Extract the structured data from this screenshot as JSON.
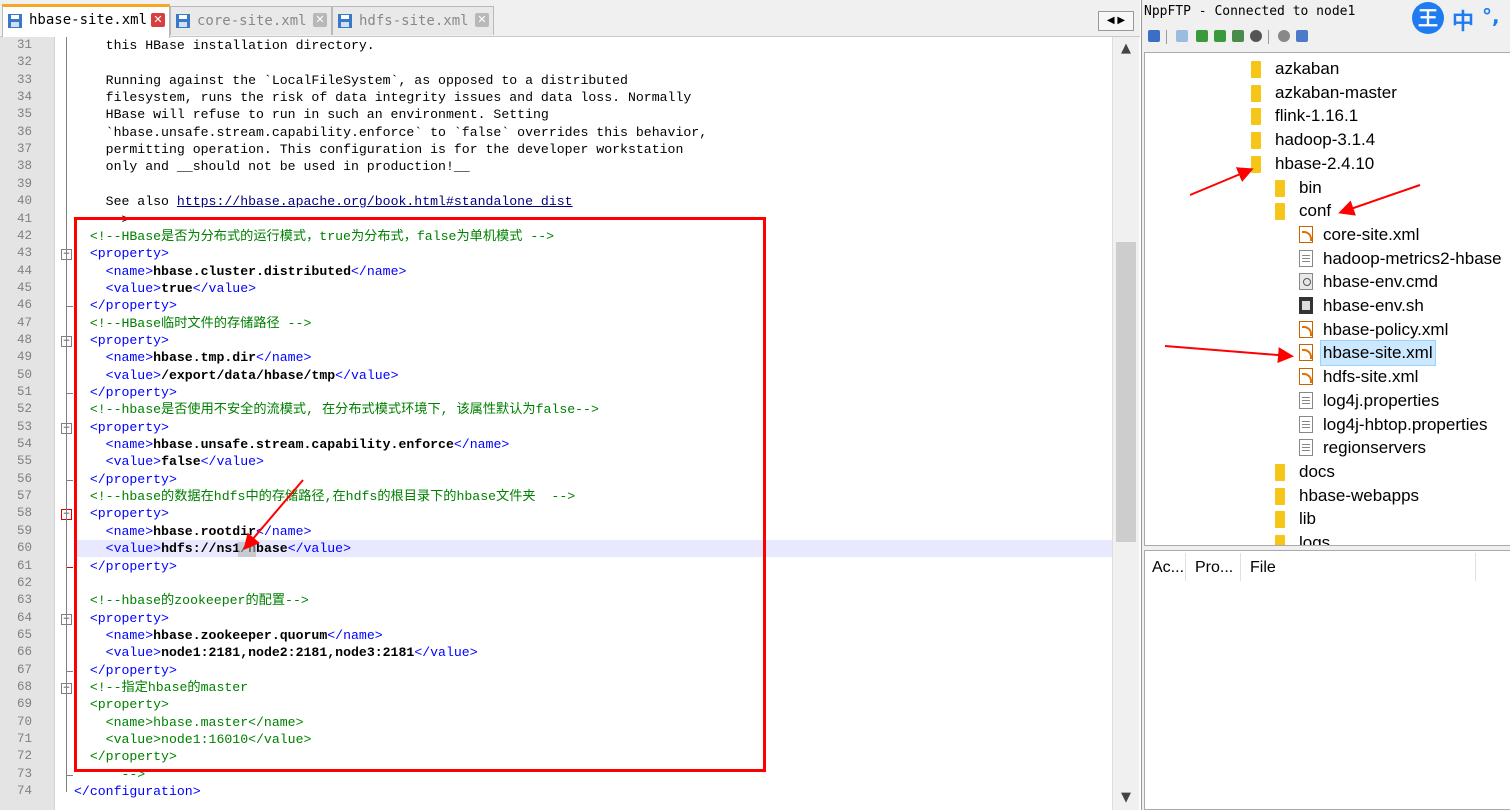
{
  "editor": {
    "tabs": [
      {
        "label": "hbase-site.xml",
        "active": true
      },
      {
        "label": "core-site.xml",
        "active": false
      },
      {
        "label": "hdfs-site.xml",
        "active": false
      }
    ],
    "tab_arrows": "◀ ▶",
    "lines": [
      {
        "n": "31",
        "parts": [
          [
            "plain",
            "    this HBase installation directory."
          ]
        ]
      },
      {
        "n": "32",
        "parts": []
      },
      {
        "n": "33",
        "parts": [
          [
            "plain",
            "    Running against the `LocalFileSystem`, as opposed to a distributed"
          ]
        ]
      },
      {
        "n": "34",
        "parts": [
          [
            "plain",
            "    filesystem, runs the risk of data integrity issues and data loss. Normally"
          ]
        ]
      },
      {
        "n": "35",
        "parts": [
          [
            "plain",
            "    HBase will refuse to run in such an environment. Setting"
          ]
        ]
      },
      {
        "n": "36",
        "parts": [
          [
            "plain",
            "    `hbase.unsafe.stream.capability.enforce` to `false` overrides this behavior,"
          ]
        ]
      },
      {
        "n": "37",
        "parts": [
          [
            "plain",
            "    permitting operation. This configuration is for the developer workstation"
          ]
        ]
      },
      {
        "n": "38",
        "parts": [
          [
            "plain",
            "    only and __should not be used in production!__"
          ]
        ]
      },
      {
        "n": "39",
        "parts": []
      },
      {
        "n": "40",
        "parts": [
          [
            "plain",
            "    See also "
          ],
          [
            "link",
            "https://hbase.apache.org/book.html#standalone_dist"
          ]
        ]
      },
      {
        "n": "41",
        "parts": [
          [
            "plain",
            "    -->"
          ]
        ]
      },
      {
        "n": "42",
        "parts": [
          [
            "comment",
            "  <!--HBase是否为分布式的运行模式，true为分布式，false为单机模式 -->"
          ]
        ]
      },
      {
        "n": "43",
        "parts": [
          [
            "tag",
            "  <property>"
          ]
        ]
      },
      {
        "n": "44",
        "parts": [
          [
            "tag",
            "    <name>"
          ],
          [
            "text",
            "hbase.cluster.distributed"
          ],
          [
            "tag",
            "</name>"
          ]
        ]
      },
      {
        "n": "45",
        "parts": [
          [
            "tag",
            "    <value>"
          ],
          [
            "text",
            "true"
          ],
          [
            "tag",
            "</value>"
          ]
        ]
      },
      {
        "n": "46",
        "parts": [
          [
            "tag",
            "  </property>"
          ]
        ]
      },
      {
        "n": "47",
        "parts": [
          [
            "comment",
            "  <!--HBase临时文件的存储路径 -->"
          ]
        ]
      },
      {
        "n": "48",
        "parts": [
          [
            "tag",
            "  <property>"
          ]
        ]
      },
      {
        "n": "49",
        "parts": [
          [
            "tag",
            "    <name>"
          ],
          [
            "text",
            "hbase.tmp.dir"
          ],
          [
            "tag",
            "</name>"
          ]
        ]
      },
      {
        "n": "50",
        "parts": [
          [
            "tag",
            "    <value>"
          ],
          [
            "text",
            "/export/data/hbase/tmp"
          ],
          [
            "tag",
            "</value>"
          ]
        ]
      },
      {
        "n": "51",
        "parts": [
          [
            "tag",
            "  </property>"
          ]
        ]
      },
      {
        "n": "52",
        "parts": [
          [
            "comment",
            "  <!--hbase是否使用不安全的流模式, 在分布式模式环境下, 该属性默认为false-->"
          ]
        ]
      },
      {
        "n": "53",
        "parts": [
          [
            "tag",
            "  <property>"
          ]
        ]
      },
      {
        "n": "54",
        "parts": [
          [
            "tag",
            "    <name>"
          ],
          [
            "text",
            "hbase.unsafe.stream.capability.enforce"
          ],
          [
            "tag",
            "</name>"
          ]
        ]
      },
      {
        "n": "55",
        "parts": [
          [
            "tag",
            "    <value>"
          ],
          [
            "text",
            "false"
          ],
          [
            "tag",
            "</value>"
          ]
        ]
      },
      {
        "n": "56",
        "parts": [
          [
            "tag",
            "  </property>"
          ]
        ]
      },
      {
        "n": "57",
        "parts": [
          [
            "comment",
            "  <!--hbase的数据在hdfs中的存储路径,在hdfs的根目录下的hbase文件夹  -->"
          ]
        ]
      },
      {
        "n": "58",
        "parts": [
          [
            "tag",
            "  <property>"
          ]
        ]
      },
      {
        "n": "59",
        "parts": [
          [
            "tag",
            "    <name>"
          ],
          [
            "text",
            "hbase.rootdir"
          ],
          [
            "tag",
            "</name>"
          ]
        ]
      },
      {
        "n": "60",
        "parts": [
          [
            "tag",
            "    <value>"
          ],
          [
            "text",
            "hdfs://ns1/hbase"
          ],
          [
            "tag",
            "</value>"
          ]
        ]
      },
      {
        "n": "61",
        "parts": [
          [
            "tag",
            "  </property>"
          ]
        ]
      },
      {
        "n": "62",
        "parts": []
      },
      {
        "n": "63",
        "parts": [
          [
            "comment",
            "  <!--hbase的zookeeper的配置-->"
          ]
        ]
      },
      {
        "n": "64",
        "parts": [
          [
            "tag",
            "  <property>"
          ]
        ]
      },
      {
        "n": "65",
        "parts": [
          [
            "tag",
            "    <name>"
          ],
          [
            "text",
            "hbase.zookeeper.quorum"
          ],
          [
            "tag",
            "</name>"
          ]
        ]
      },
      {
        "n": "66",
        "parts": [
          [
            "tag",
            "    <value>"
          ],
          [
            "text",
            "node1:2181,node2:2181,node3:2181"
          ],
          [
            "tag",
            "</value>"
          ]
        ]
      },
      {
        "n": "67",
        "parts": [
          [
            "tag",
            "  </property>"
          ]
        ]
      },
      {
        "n": "68",
        "parts": [
          [
            "comment",
            "  <!--指定hbase的master"
          ]
        ]
      },
      {
        "n": "69",
        "parts": [
          [
            "comment",
            "  <property>"
          ]
        ]
      },
      {
        "n": "70",
        "parts": [
          [
            "comment",
            "    <name>hbase.master</name>"
          ]
        ]
      },
      {
        "n": "71",
        "parts": [
          [
            "comment",
            "    <value>node1:16010</value>"
          ]
        ]
      },
      {
        "n": "72",
        "parts": [
          [
            "comment",
            "  </property>"
          ]
        ]
      },
      {
        "n": "73",
        "parts": [
          [
            "comment",
            "      -->"
          ]
        ]
      },
      {
        "n": "74",
        "parts": [
          [
            "tag",
            "</configuration>"
          ]
        ]
      }
    ],
    "highlighted_line": "60"
  },
  "sidebar": {
    "title": "NppFTP - Connected to node1",
    "ime": {
      "badge": "王",
      "mode": "中",
      "punct": "°,"
    },
    "tree": [
      {
        "label": "azkaban",
        "type": "folder",
        "depth": 0
      },
      {
        "label": "azkaban-master",
        "type": "folder",
        "depth": 0
      },
      {
        "label": "flink-1.16.1",
        "type": "folder",
        "depth": 0
      },
      {
        "label": "hadoop-3.1.4",
        "type": "folder",
        "depth": 0
      },
      {
        "label": "hbase-2.4.10",
        "type": "folder",
        "depth": 0
      },
      {
        "label": "bin",
        "type": "folder",
        "depth": 1
      },
      {
        "label": "conf",
        "type": "folder",
        "depth": 1
      },
      {
        "label": "core-site.xml",
        "type": "rss",
        "depth": 2
      },
      {
        "label": "hadoop-metrics2-hbase",
        "type": "plain",
        "depth": 2
      },
      {
        "label": "hbase-env.cmd",
        "type": "gear",
        "depth": 2
      },
      {
        "label": "hbase-env.sh",
        "type": "term",
        "depth": 2
      },
      {
        "label": "hbase-policy.xml",
        "type": "rss",
        "depth": 2
      },
      {
        "label": "hbase-site.xml",
        "type": "rss",
        "depth": 2,
        "selected": true
      },
      {
        "label": "hdfs-site.xml",
        "type": "rss",
        "depth": 2
      },
      {
        "label": "log4j.properties",
        "type": "plain",
        "depth": 2
      },
      {
        "label": "log4j-hbtop.properties",
        "type": "plain",
        "depth": 2
      },
      {
        "label": "regionservers",
        "type": "plain",
        "depth": 2
      },
      {
        "label": "docs",
        "type": "folder",
        "depth": 1
      },
      {
        "label": "hbase-webapps",
        "type": "folder",
        "depth": 1
      },
      {
        "label": "lib",
        "type": "folder",
        "depth": 1
      },
      {
        "label": "logs",
        "type": "folder",
        "depth": 1
      }
    ],
    "queue_headers": [
      "Ac...",
      "Pro...",
      "File"
    ]
  },
  "colors": {
    "annotation_red": "#ff0000",
    "tab_accent": "#f5a623",
    "comment": "#008000",
    "tag": "#0000ff"
  }
}
